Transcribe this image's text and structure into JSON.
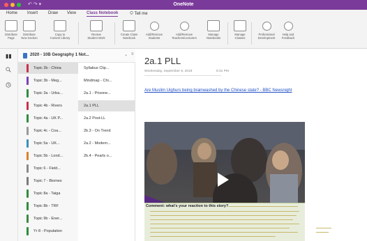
{
  "window": {
    "title": "OneNote",
    "quick_access": "↶ ↷ ▾"
  },
  "tabs": [
    "Home",
    "Insert",
    "Draw",
    "View",
    "Class Notebook",
    "Tell me"
  ],
  "tell_me_icon": "lightbulb-icon",
  "ribbon": [
    {
      "label": "Distribute\nPage",
      "icon": "distribute-page-icon"
    },
    {
      "label": "Distribute\nNew Section",
      "icon": "distribute-section-icon"
    },
    {
      "label": "Copy to\nContent Library",
      "icon": "copy-library-icon"
    },
    {
      "label": "Review\nStudent Work",
      "icon": "review-icon"
    },
    {
      "label": "Create Class\nNotebook",
      "icon": "create-notebook-icon"
    },
    {
      "label": "Add/Remove\nStudents",
      "icon": "students-icon"
    },
    {
      "label": "Add/Remove\nTeachers/Lecturers",
      "icon": "teachers-icon"
    },
    {
      "label": "Manage\nNotebooks",
      "icon": "notebooks-icon"
    },
    {
      "label": "Manage\nClasses",
      "icon": "classes-icon"
    },
    {
      "label": "Professional\nDevelopment",
      "icon": "globe-icon"
    },
    {
      "label": "Help and\nFeedback",
      "icon": "help-icon"
    }
  ],
  "rail": {
    "notebooks_icon": "library-icon",
    "search_icon": "search-icon",
    "recent_icon": "clock-icon"
  },
  "notebook": {
    "name": "2020 - 10B Geography 1 Not...",
    "chevron": "⌄",
    "sort": "≡"
  },
  "sections": [
    {
      "label": "Topic 2b - China",
      "color": "#c8304e",
      "active": true
    },
    {
      "label": "Topic 3b - Meg...",
      "color": "#7d3fb5",
      "active": false
    },
    {
      "label": "Topic 3a - Urba...",
      "color": "#2f8d3e",
      "active": false
    },
    {
      "label": "Topic 4b - Rivers",
      "color": "#c8304e",
      "active": false
    },
    {
      "label": "Topic 4a - UK P...",
      "color": "#2f8d3e",
      "active": false
    },
    {
      "label": "Topic 4c - Coa...",
      "color": "#9a9a9a",
      "active": false
    },
    {
      "label": "Topic 5a - UK...",
      "color": "#3d8fb8",
      "active": false
    },
    {
      "label": "Topic 5b - Lond...",
      "color": "#d9832a",
      "active": false
    },
    {
      "label": "Topic 6 - Field...",
      "color": "#8a8a8a",
      "active": false
    },
    {
      "label": "Topic 7 - Biomes",
      "color": "#7a7a7a",
      "active": false
    },
    {
      "label": "Topic 8a - Taiga",
      "color": "#2f8d3e",
      "active": false
    },
    {
      "label": "Topic 8b - TRF",
      "color": "#2f8d3e",
      "active": false
    },
    {
      "label": "Topic 9b - Ener...",
      "color": "#3a8b3f",
      "active": false
    },
    {
      "label": "Yr 8 - Population",
      "color": "#2f8d3e",
      "active": false
    }
  ],
  "pages": [
    {
      "label": "Syllabus Clip...",
      "active": false
    },
    {
      "label": "Mindmap - Chi...",
      "active": false
    },
    {
      "label": "2a.1 - Prisone...",
      "active": false
    },
    {
      "label": "2a.1 PLL",
      "active": true
    },
    {
      "label": "2a.2 Post-LL",
      "active": false
    },
    {
      "label": "2b.3 - On Trend",
      "active": false
    },
    {
      "label": "2a.2 - Modern...",
      "active": false
    },
    {
      "label": "2b.4 - Pearls o...",
      "active": false
    }
  ],
  "page": {
    "title": "2a.1 PLL",
    "date": "Wednesday, September 5, 2018",
    "time": "8:31 PM",
    "link": "Are Muslim Uighurs being brainwashed by the Chinese state? - BBC Newsnight",
    "video_bbc": "BBC",
    "video_brand": "newsnight",
    "video_play_icon": "play-icon",
    "comment_label": "Comment: what's your reaction to this story?"
  },
  "colors": {
    "accent": "#7a3a9a",
    "link": "#1f4fc4",
    "comment_bg": "#e8eddb"
  }
}
